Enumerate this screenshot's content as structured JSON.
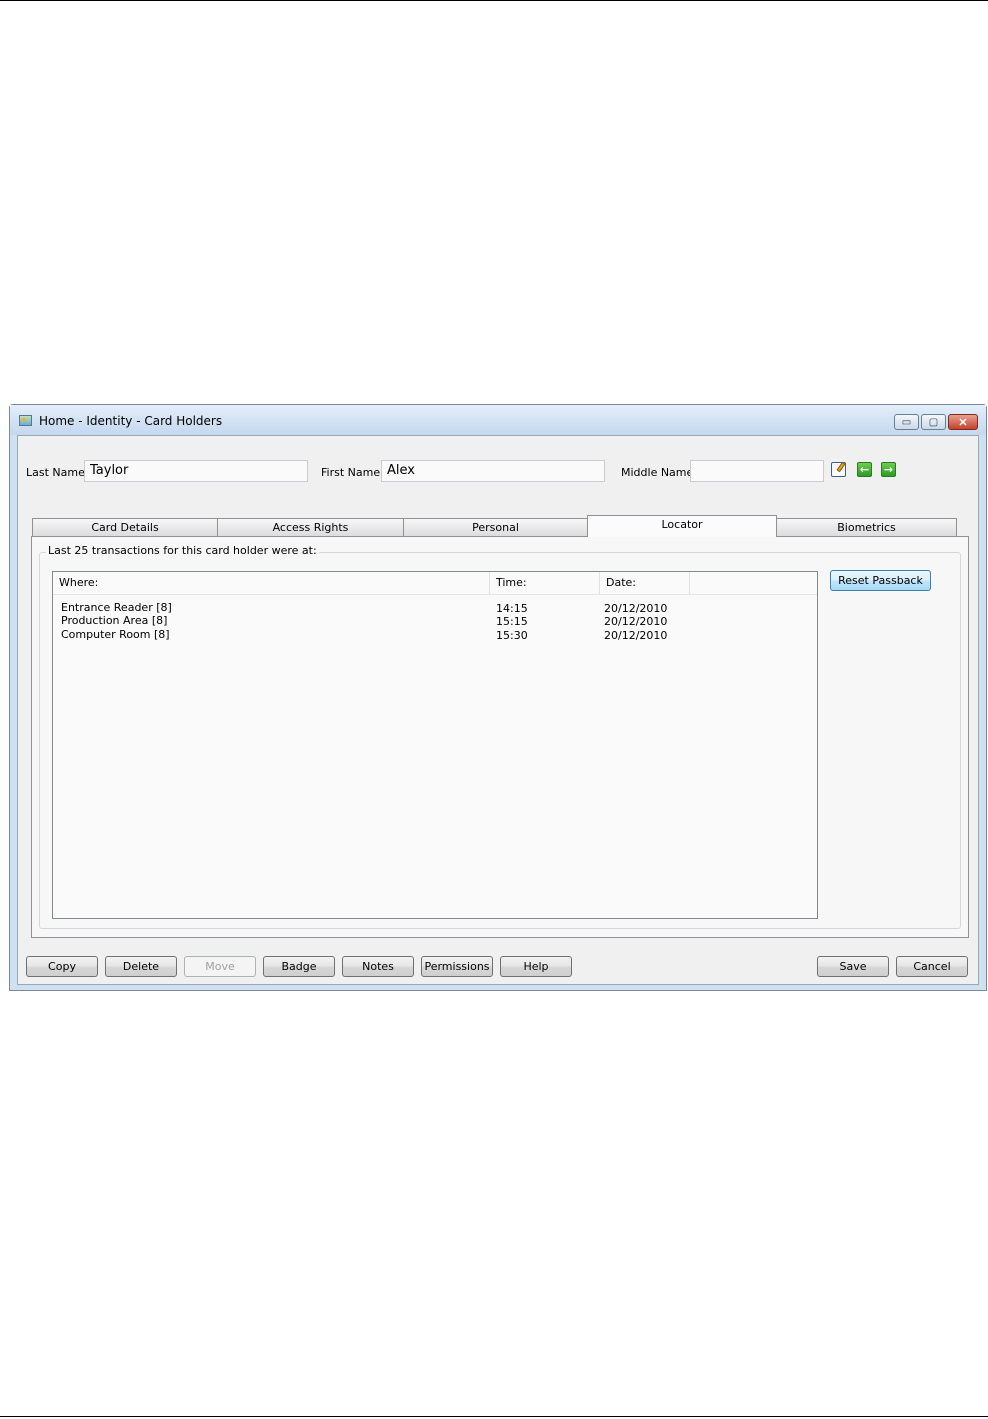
{
  "window": {
    "title": "Home - Identity - Card Holders",
    "controls": {
      "minimize": "▭",
      "maximize": "▢",
      "close": "✕"
    }
  },
  "header": {
    "last_name_label": "Last Name:",
    "last_name_value": "Taylor",
    "first_name_label": "First Name:",
    "first_name_value": "Alex",
    "middle_name_label": "Middle Name:",
    "middle_name_value": "",
    "icons": [
      "edit-icon",
      "back-arrow-icon",
      "forward-arrow-icon"
    ]
  },
  "tabs": [
    {
      "label": "Card Details",
      "active": false
    },
    {
      "label": "Access Rights",
      "active": false
    },
    {
      "label": "Personal",
      "active": false
    },
    {
      "label": "Locator",
      "active": true
    },
    {
      "label": "Biometrics",
      "active": false
    }
  ],
  "locator": {
    "caption": "Last 25 transactions for this card holder were at:",
    "columns": [
      "Where:",
      "Time:",
      "Date:"
    ],
    "rows": [
      {
        "where": "Entrance Reader [8]",
        "time": "14:15",
        "date": "20/12/2010"
      },
      {
        "where": "Production Area [8]",
        "time": "15:15",
        "date": "20/12/2010"
      },
      {
        "where": "Computer Room [8]",
        "time": "15:30",
        "date": "20/12/2010"
      }
    ],
    "reset_button": "Reset Passback"
  },
  "footer": {
    "left_buttons": [
      {
        "label": "Copy",
        "enabled": true
      },
      {
        "label": "Delete",
        "enabled": true
      },
      {
        "label": "Move",
        "enabled": false
      },
      {
        "label": "Badge",
        "enabled": true
      },
      {
        "label": "Notes",
        "enabled": true
      },
      {
        "label": "Permissions",
        "enabled": true
      },
      {
        "label": "Help",
        "enabled": true
      }
    ],
    "right_buttons": [
      {
        "label": "Save",
        "enabled": true
      },
      {
        "label": "Cancel",
        "enabled": true
      }
    ]
  },
  "colors": {
    "window_frame": "#cfe0f1",
    "client_bg": "#f0f0f0",
    "close_button": "#c4412b",
    "nav_arrow": "#2e9a24"
  }
}
